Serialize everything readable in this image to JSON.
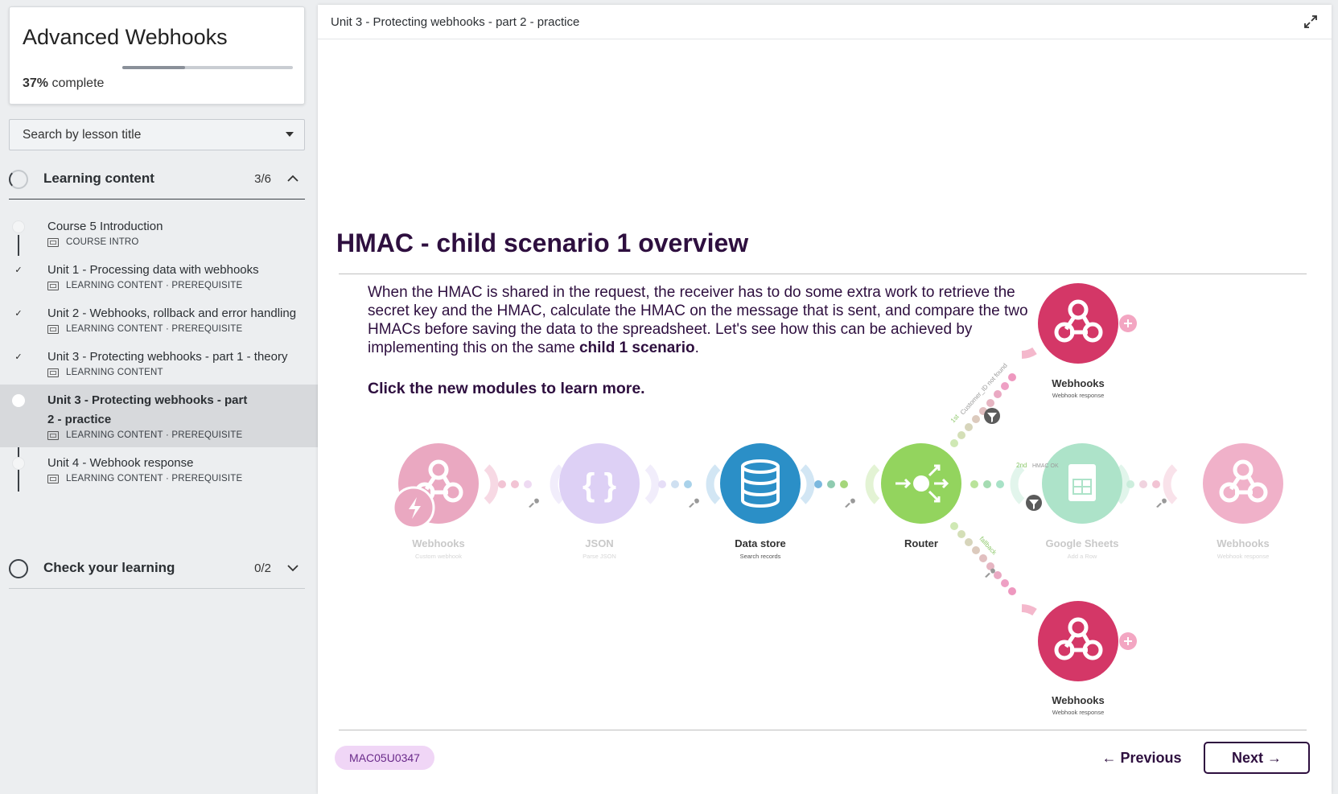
{
  "sidebar": {
    "course_title": "Advanced Webhooks",
    "progress_percent": "37%",
    "progress_value": 0.37,
    "progress_suffix": "complete",
    "search_placeholder": "Search by lesson title",
    "sections": [
      {
        "label": "Learning content",
        "count": "3/6",
        "expanded": true
      },
      {
        "label": "Check your learning",
        "count": "0/2",
        "expanded": false
      }
    ],
    "lessons": [
      {
        "title": "Course 5 Introduction",
        "meta": "COURSE INTRO",
        "status": "not-started"
      },
      {
        "title": "Unit 1 - Processing data with webhooks",
        "meta": "LEARNING CONTENT · PREREQUISITE",
        "status": "complete"
      },
      {
        "title": "Unit 2 - Webhooks, rollback and error handling",
        "meta": "LEARNING CONTENT · PREREQUISITE",
        "status": "complete"
      },
      {
        "title": "Unit 3 - Protecting webhooks - part 1 - theory",
        "meta": "LEARNING CONTENT",
        "status": "complete"
      },
      {
        "title": "Unit 3 - Protecting webhooks - part 2 - practice",
        "meta": "LEARNING CONTENT · PREREQUISITE",
        "status": "current"
      },
      {
        "title": "Unit 4 - Webhook response",
        "meta": "LEARNING CONTENT · PREREQUISITE",
        "status": "not-started"
      }
    ]
  },
  "main": {
    "breadcrumb": "Unit 3 - Protecting webhooks - part 2 - practice",
    "slide": {
      "title": "HMAC - child scenario 1 overview",
      "body_before": "When the HMAC is shared in the request, the receiver has to do some extra work to retrieve the secret key and the HMAC, calculate the HMAC on the message that is sent, and compare the two HMACs before saving the data to the spreadsheet. Let's see how this can be achieved by implementing this on the same ",
      "body_bold": "child 1 scenario",
      "body_after": ".",
      "cta": "Click the new modules to learn more",
      "cta_suffix": "."
    },
    "diagram": {
      "modules": [
        {
          "name": "Webhooks",
          "sub": "Custom webhook",
          "color": "#e9a6c0",
          "faded": true
        },
        {
          "name": "JSON",
          "sub": "Parse JSON",
          "color": "#d8c9f2",
          "faded": true
        },
        {
          "name": "Data store",
          "sub": "Search records",
          "color": "#2b8fc7",
          "faded": false
        },
        {
          "name": "Router",
          "sub": "",
          "color": "#93d45e",
          "faded": false
        },
        {
          "name": "Google Sheets",
          "sub": "Add a Row",
          "color": "#a8e2c7",
          "faded": true
        },
        {
          "name": "Webhooks",
          "sub": "Webhook response",
          "color": "#eeaec8",
          "faded": true
        },
        {
          "name": "Webhooks",
          "sub": "Webhook response",
          "color": "#d43767",
          "faded": false
        },
        {
          "name": "Webhooks",
          "sub": "Webhook response",
          "color": "#d43767",
          "faded": false
        }
      ],
      "route_labels": [
        "1st",
        "Customer_ID not found",
        "2nd",
        "HMAC OK",
        "fallback"
      ]
    },
    "footer": {
      "code": "MAC05U0347",
      "previous_label": "Previous",
      "next_label": "Next",
      "previous_icon": "arrow-left-icon",
      "next_icon": "arrow-right-icon"
    }
  }
}
